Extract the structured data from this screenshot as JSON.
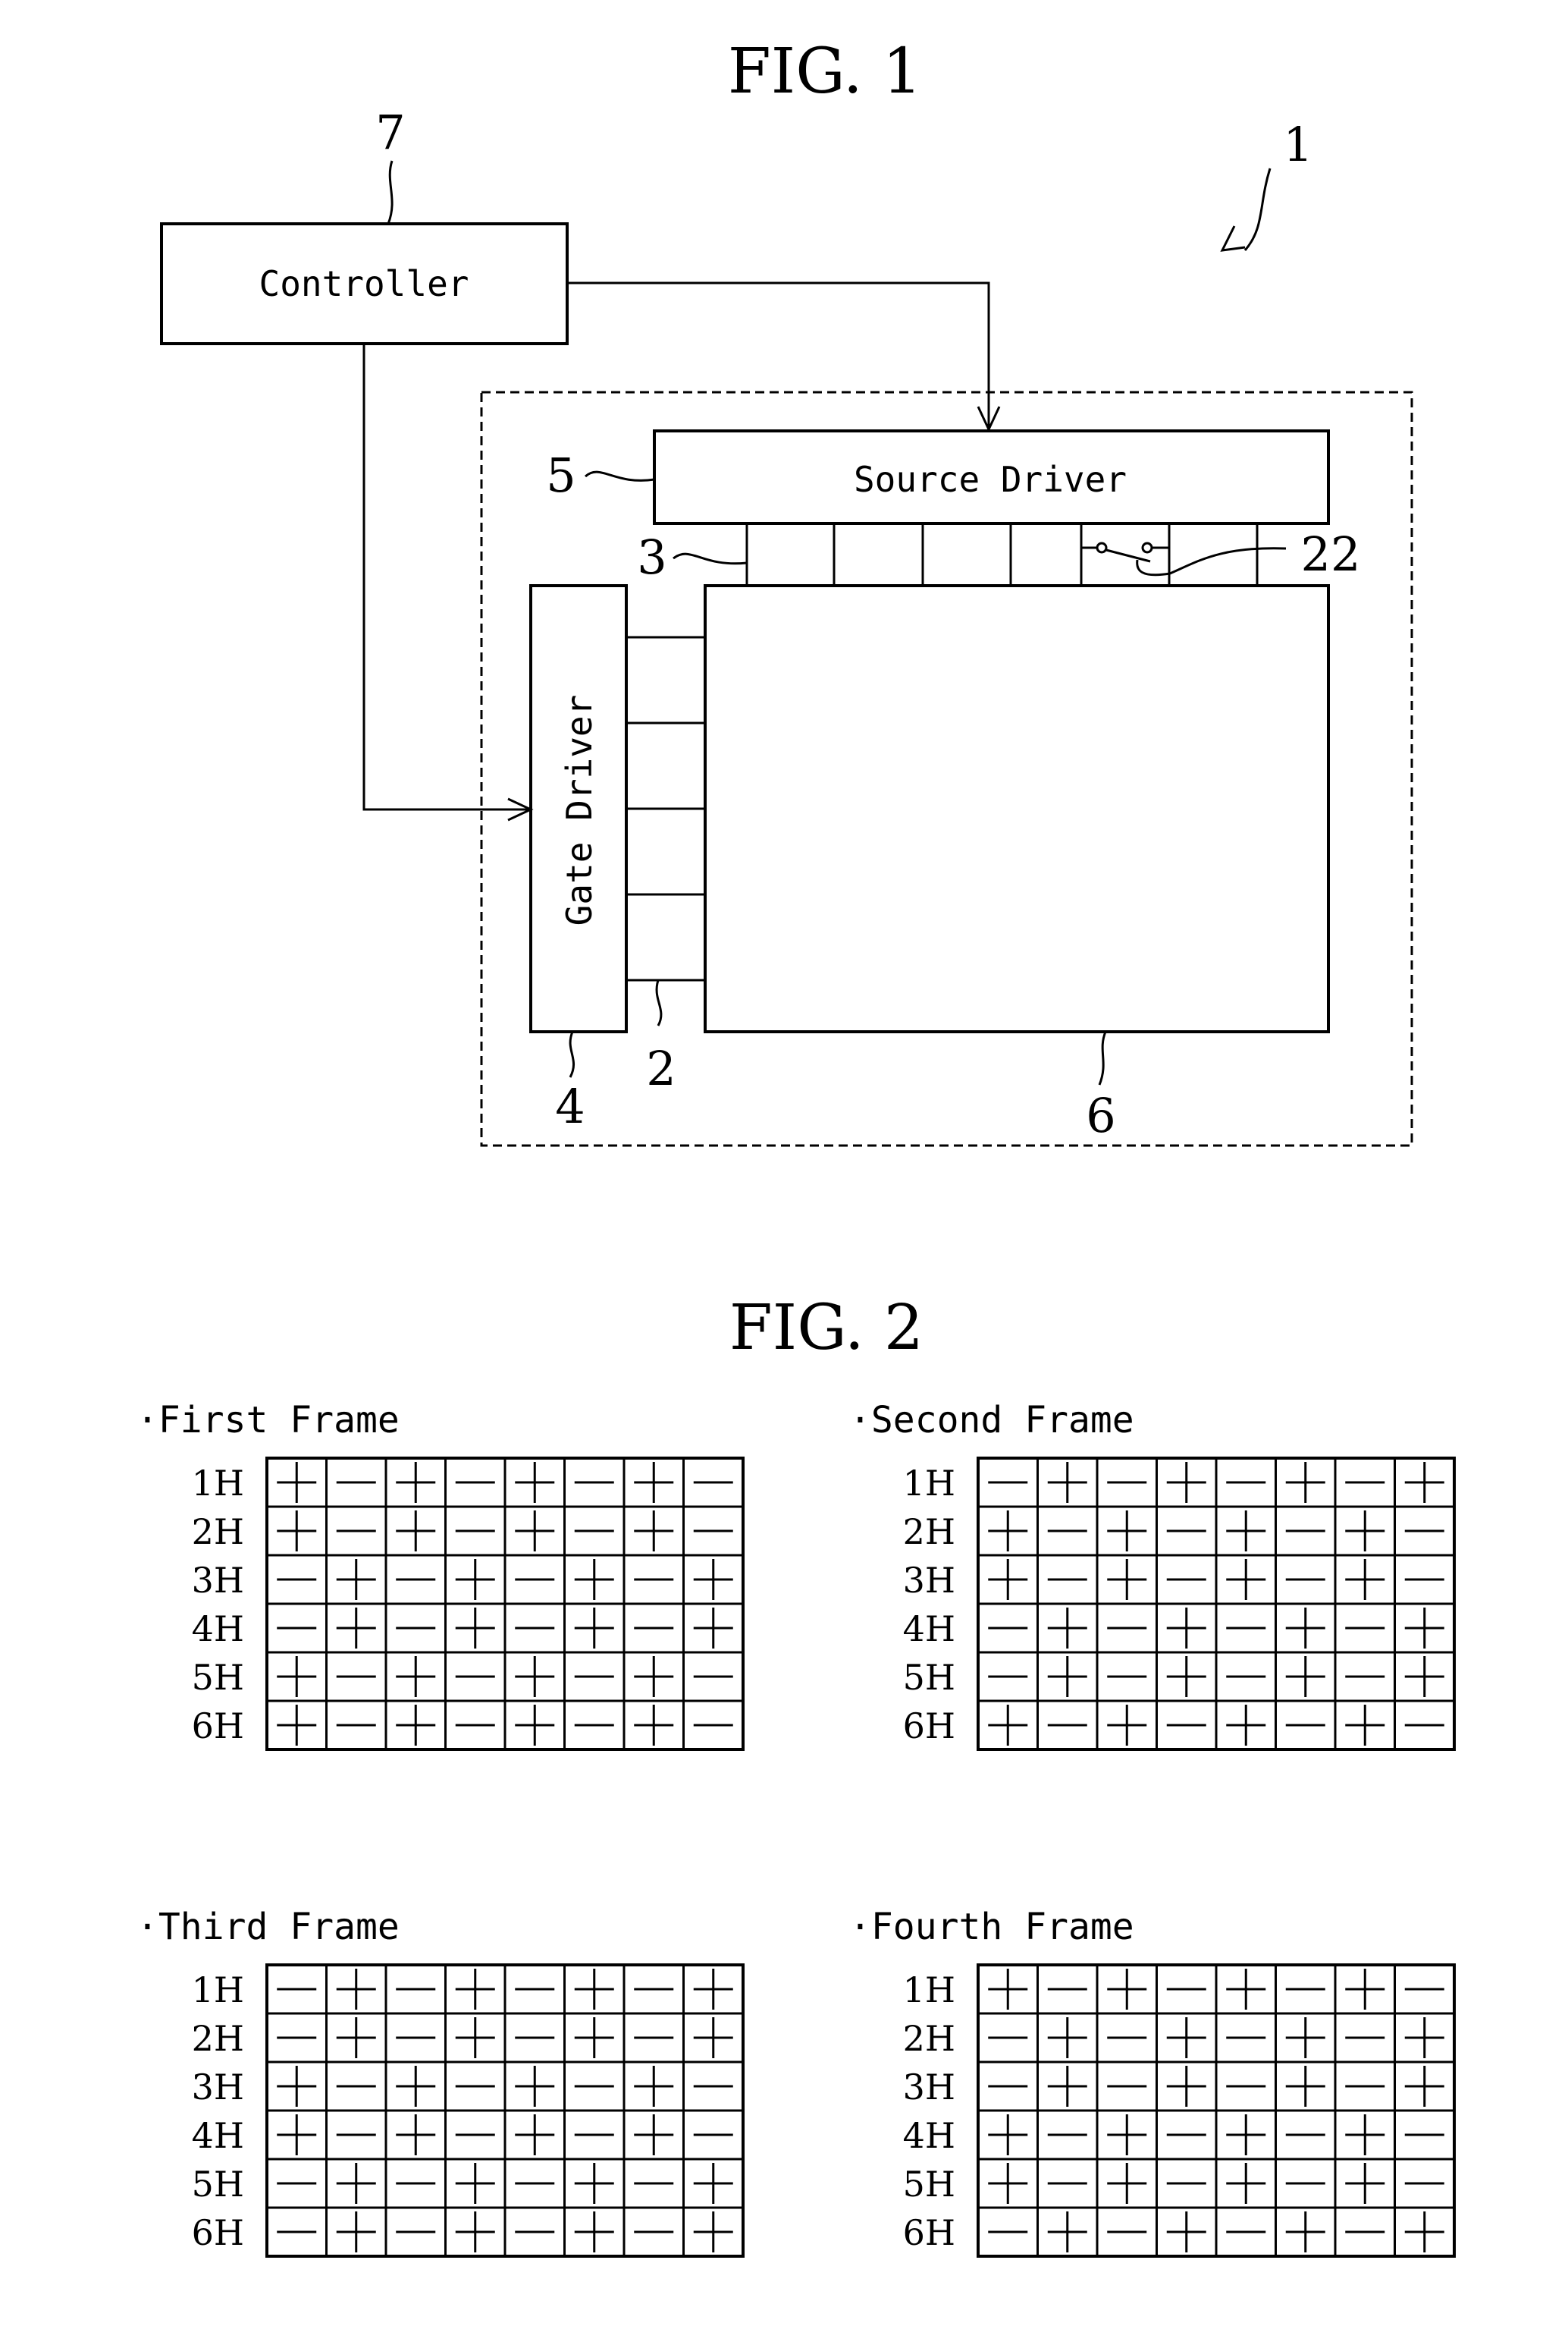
{
  "fig1": {
    "title": "FIG. 1",
    "ref_device": "1",
    "controller": {
      "label": "Controller",
      "ref": "7"
    },
    "source_driver": {
      "label": "Source Driver",
      "ref": "5"
    },
    "gate_driver": {
      "label": "Gate Driver",
      "ref": "4"
    },
    "source_lines_ref": "3",
    "gate_lines_ref": "2",
    "panel_ref": "6",
    "switch_ref": "22"
  },
  "fig2": {
    "title": "FIG. 2",
    "row_labels": [
      "1H",
      "2H",
      "3H",
      "4H",
      "5H",
      "6H"
    ],
    "frames": [
      {
        "label": "·First Frame",
        "rows": [
          [
            "+",
            "-",
            "+",
            "-",
            "+",
            "-",
            "+",
            "-"
          ],
          [
            "+",
            "-",
            "+",
            "-",
            "+",
            "-",
            "+",
            "-"
          ],
          [
            "-",
            "+",
            "-",
            "+",
            "-",
            "+",
            "-",
            "+"
          ],
          [
            "-",
            "+",
            "-",
            "+",
            "-",
            "+",
            "-",
            "+"
          ],
          [
            "+",
            "-",
            "+",
            "-",
            "+",
            "-",
            "+",
            "-"
          ],
          [
            "+",
            "-",
            "+",
            "-",
            "+",
            "-",
            "+",
            "-"
          ]
        ]
      },
      {
        "label": "·Second Frame",
        "rows": [
          [
            "-",
            "+",
            "-",
            "+",
            "-",
            "+",
            "-",
            "+"
          ],
          [
            "+",
            "-",
            "+",
            "-",
            "+",
            "-",
            "+",
            "-"
          ],
          [
            "+",
            "-",
            "+",
            "-",
            "+",
            "-",
            "+",
            "-"
          ],
          [
            "-",
            "+",
            "-",
            "+",
            "-",
            "+",
            "-",
            "+"
          ],
          [
            "-",
            "+",
            "-",
            "+",
            "-",
            "+",
            "-",
            "+"
          ],
          [
            "+",
            "-",
            "+",
            "-",
            "+",
            "-",
            "+",
            "-"
          ]
        ]
      },
      {
        "label": "·Third Frame",
        "rows": [
          [
            "-",
            "+",
            "-",
            "+",
            "-",
            "+",
            "-",
            "+"
          ],
          [
            "-",
            "+",
            "-",
            "+",
            "-",
            "+",
            "-",
            "+"
          ],
          [
            "+",
            "-",
            "+",
            "-",
            "+",
            "-",
            "+",
            "-"
          ],
          [
            "+",
            "-",
            "+",
            "-",
            "+",
            "-",
            "+",
            "-"
          ],
          [
            "-",
            "+",
            "-",
            "+",
            "-",
            "+",
            "-",
            "+"
          ],
          [
            "-",
            "+",
            "-",
            "+",
            "-",
            "+",
            "-",
            "+"
          ]
        ]
      },
      {
        "label": "·Fourth Frame",
        "rows": [
          [
            "+",
            "-",
            "+",
            "-",
            "+",
            "-",
            "+",
            "-"
          ],
          [
            "-",
            "+",
            "-",
            "+",
            "-",
            "+",
            "-",
            "+"
          ],
          [
            "-",
            "+",
            "-",
            "+",
            "-",
            "+",
            "-",
            "+"
          ],
          [
            "+",
            "-",
            "+",
            "-",
            "+",
            "-",
            "+",
            "-"
          ],
          [
            "+",
            "-",
            "+",
            "-",
            "+",
            "-",
            "+",
            "-"
          ],
          [
            "-",
            "+",
            "-",
            "+",
            "-",
            "+",
            "-",
            "+"
          ]
        ]
      }
    ]
  }
}
